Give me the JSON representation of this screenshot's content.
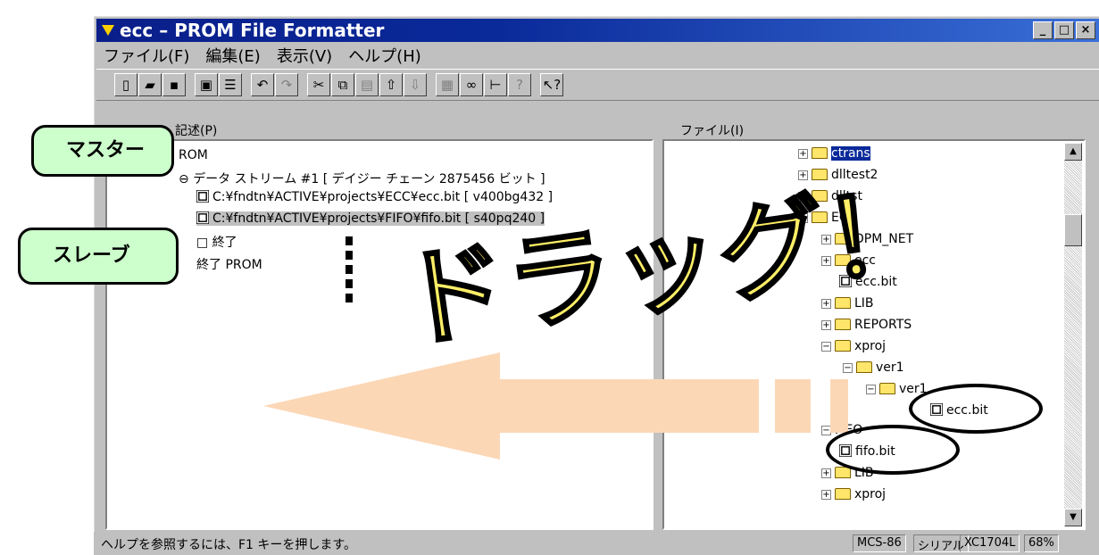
{
  "window": {
    "title": "ecc – PROM File Formatter",
    "controls": [
      "_",
      "□",
      "×"
    ]
  },
  "menu": [
    "ファイル(F)",
    "編集(E)",
    "表示(V)",
    "ヘルプ(H)"
  ],
  "toolbar_icons": [
    "new-icon",
    "open-icon",
    "save-icon",
    "format-icon",
    "properties-icon",
    "undo-icon",
    "redo-icon",
    "cut-icon",
    "copy-icon",
    "paste-icon",
    "move-up-icon",
    "move-down-icon",
    "chip-icon",
    "link-icon",
    "tree-icon",
    "help-icon",
    "context-help-icon"
  ],
  "left_pane": {
    "label": "記述(P)",
    "rows": [
      {
        "text": "ROM"
      },
      {
        "text": "データ ストリーム #1 [ デイジー チェーン 2875456 ビット ]"
      },
      {
        "text": "C:¥fndtn¥ACTIVE¥projects¥ECC¥ecc.bit   [ v400bg432 ]"
      },
      {
        "text": "C:¥fndtn¥ACTIVE¥projects¥FIFO¥fifo.bit   [ s40pq240 ]"
      },
      {
        "text": "□ 終了"
      },
      {
        "text": "終了 PROM"
      }
    ]
  },
  "right_pane": {
    "label": "ファイル(I)",
    "rows": [
      {
        "text": "ctrans"
      },
      {
        "text": "dlltest2"
      },
      {
        "text": "dlltst"
      },
      {
        "text": "ECC"
      },
      {
        "text": "DPM_NET"
      },
      {
        "text": "ecc"
      },
      {
        "text": "ecc.bit"
      },
      {
        "text": "LIB"
      },
      {
        "text": "REPORTS"
      },
      {
        "text": "xproj"
      },
      {
        "text": "ver1"
      },
      {
        "text": "ver1"
      },
      {
        "text": "ecc.bit"
      },
      {
        "text": "FIFO"
      },
      {
        "text": "fifo.bit"
      },
      {
        "text": "LIB"
      },
      {
        "text": "xproj"
      }
    ]
  },
  "annotations": {
    "master": "マスター",
    "slave": "スレーブ",
    "drag": "ドラッグ！"
  },
  "status": {
    "text": "ヘルプを参照するには、F1 キーを押します。",
    "panels": [
      "MCS-86",
      "シリアル",
      "XC1704L",
      "68%"
    ]
  },
  "colors": {
    "accent": "#0a2a9a",
    "callout": "#ccffcc",
    "drag_text": "#ffee66",
    "arrow": "#fcd7b6"
  }
}
